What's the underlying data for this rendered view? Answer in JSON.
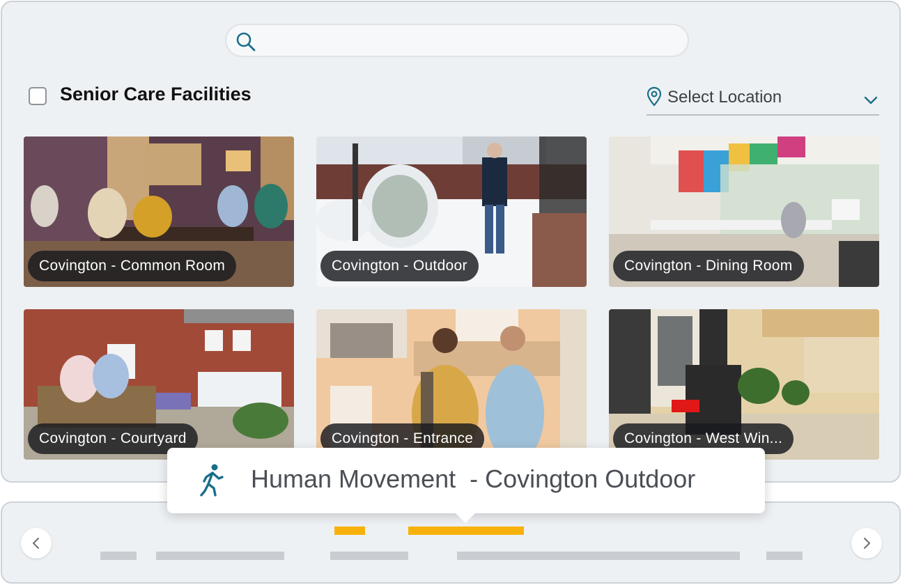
{
  "search": {
    "placeholder": "",
    "icon": "search-icon"
  },
  "header": {
    "title": "Senior Care Facilities",
    "checkbox_checked": false
  },
  "location": {
    "label": "Select Location",
    "icon": "map-pin-icon"
  },
  "cards": [
    {
      "caption": "Covington - Common Room"
    },
    {
      "caption": "Covington - Outdoor"
    },
    {
      "caption": "Covington - Dining Room"
    },
    {
      "caption": "Covington - Courtyard"
    },
    {
      "caption": "Covington - Entrance"
    },
    {
      "caption": "Covington - West Win..."
    }
  ],
  "tooltip": {
    "text": "Human Movement  - Covington Outdoor",
    "icon": "walking-person-icon"
  },
  "colors": {
    "accent": "#1a6e8a",
    "event": "#f7b10a",
    "track": "#c9cdd2",
    "panel": "#eef1f4"
  }
}
